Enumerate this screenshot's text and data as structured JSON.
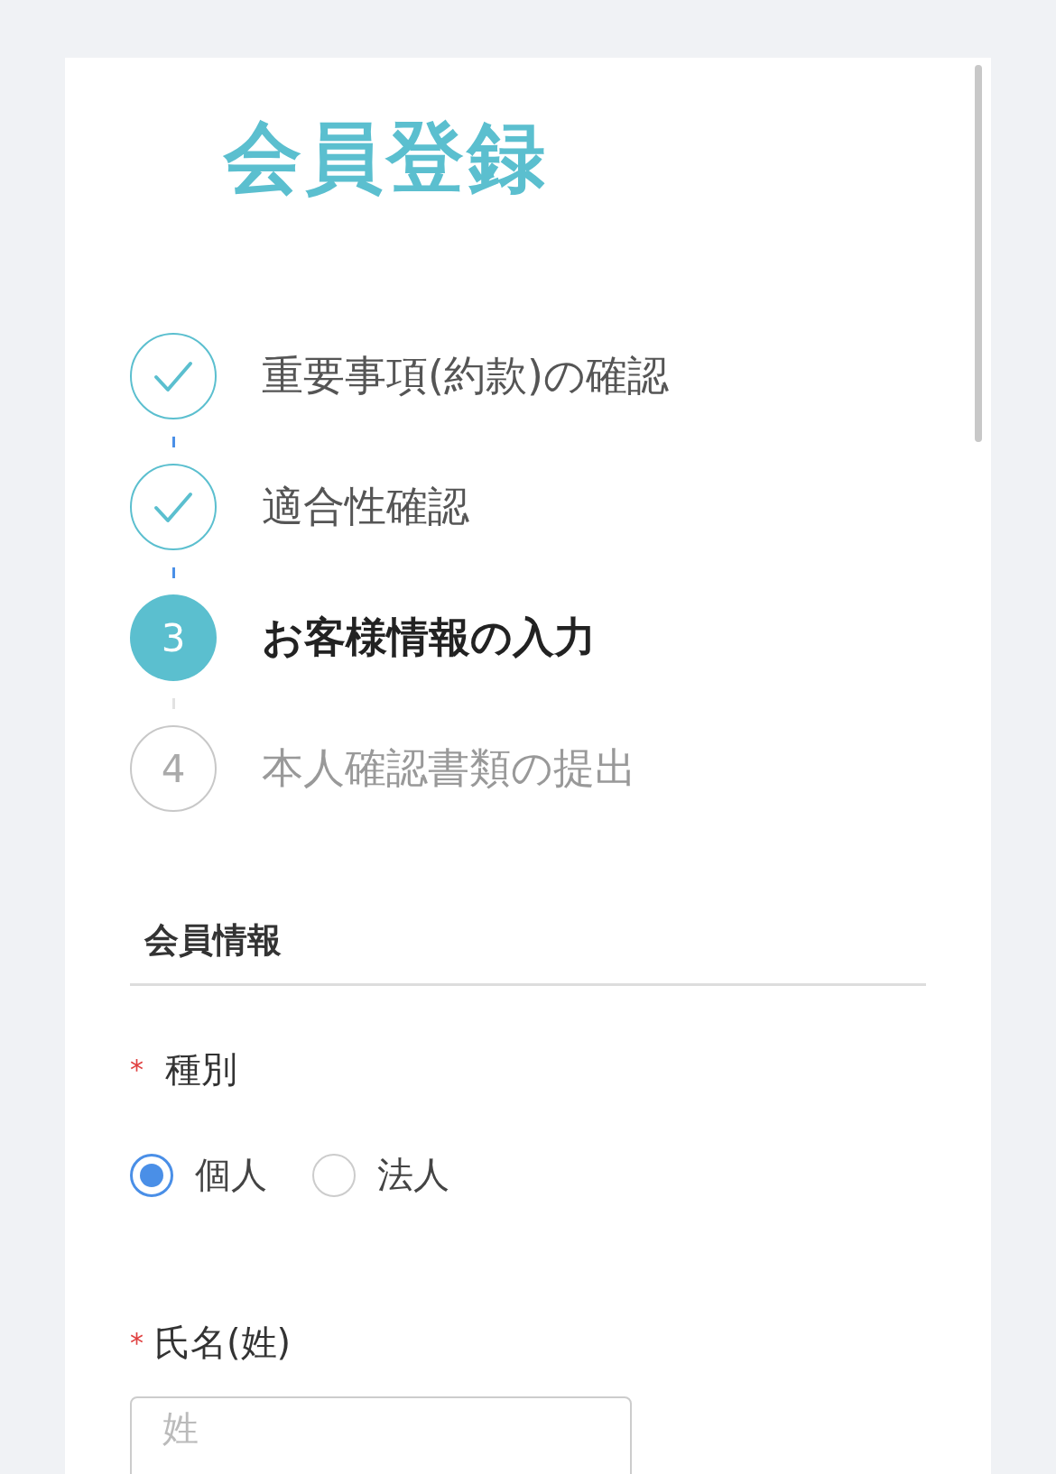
{
  "title": "会員登録",
  "steps": [
    {
      "label": "重要事項(約款)の確認",
      "done": true,
      "current": false
    },
    {
      "label": "適合性確認",
      "done": true,
      "current": false
    },
    {
      "number": "3",
      "label": "お客様情報の入力",
      "done": false,
      "current": true
    },
    {
      "number": "4",
      "label": "本人確認書類の提出",
      "done": false,
      "current": false
    }
  ],
  "section": {
    "title": "会員情報"
  },
  "fields": [
    {
      "kind": "radio",
      "required_mark": "*",
      "label": "種別",
      "options": [
        {
          "label": "個人",
          "selected": true
        },
        {
          "label": "法人",
          "selected": false
        }
      ]
    },
    {
      "kind": "text",
      "required_mark": "*",
      "label": "氏名(姓)",
      "placeholder": "姓"
    }
  ]
}
